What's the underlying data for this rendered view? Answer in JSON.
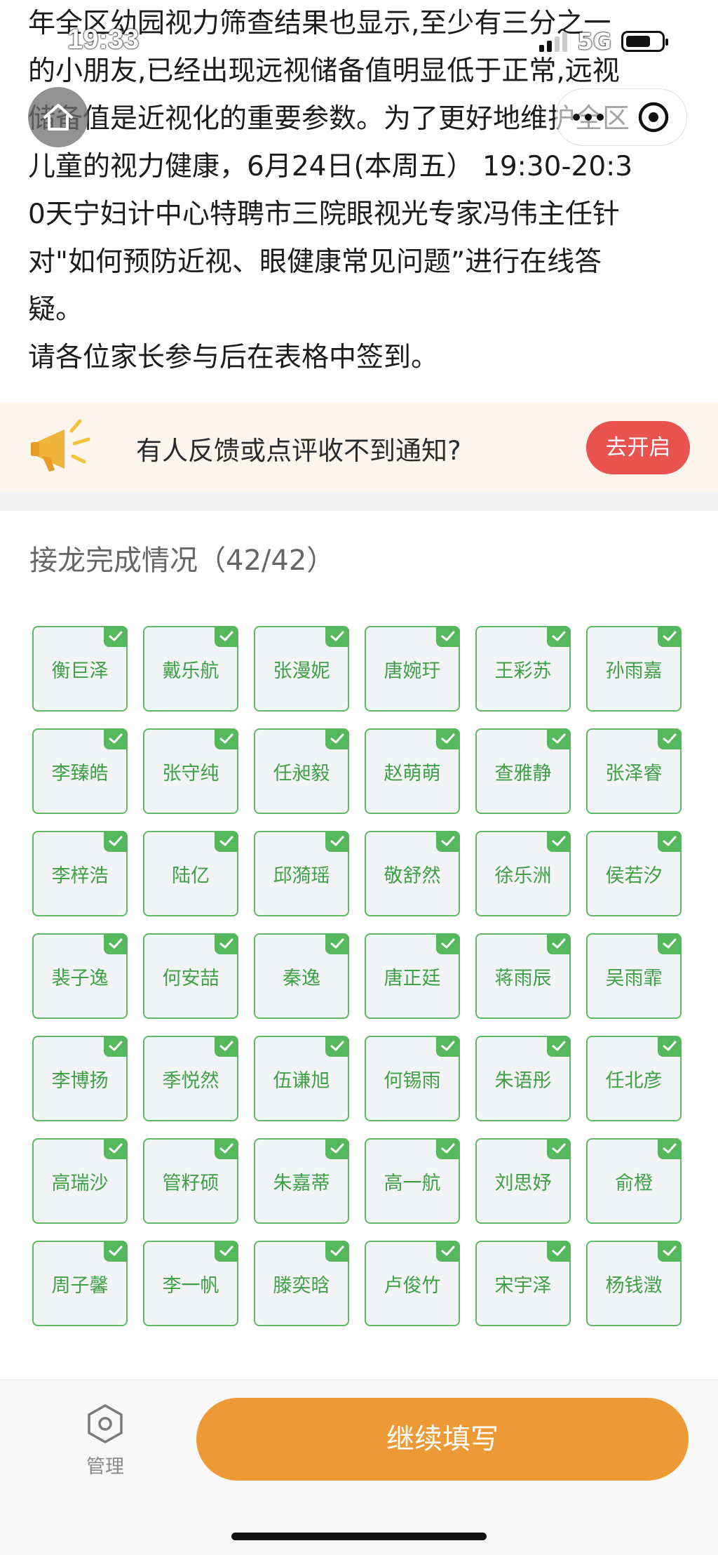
{
  "status_bar": {
    "time": "19:33",
    "network": "5G"
  },
  "article": {
    "lines": [
      "年全区幼园视力筛查结果也显示,至少有三分之一",
      "的小朋友,已经出现远视储备值明显低于正常,远视",
      "储备值是近视化的重要参数。为了更好地维护全区",
      "儿童的视力健康，6月24日(本周五） 19:30-20:3",
      "0天宁妇计中心特聘市三院眼视光专家冯伟主任针",
      "对\"如何预防近视、眼健康常见问题”进行在线答",
      "疑。"
    ],
    "signin_note": "请各位家长参与后在表格中签到。"
  },
  "banner": {
    "text": "有人反馈或点评收不到通知?",
    "button": "去开启"
  },
  "roster": {
    "title": "接龙完成情况（42/42）",
    "names": [
      "衡巨泽",
      "戴乐航",
      "张漫妮",
      "唐婉玗",
      "王彩苏",
      "孙雨嘉",
      "李臻皓",
      "张守纯",
      "任昶毅",
      "赵萌萌",
      "查雅静",
      "张泽睿",
      "李梓浩",
      "陆亿",
      "邱漪瑶",
      "敬舒然",
      "徐乐洲",
      "侯若汐",
      "裴子逸",
      "何安喆",
      "秦逸",
      "唐正廷",
      "蒋雨辰",
      "吴雨霏",
      "李博扬",
      "季悦然",
      "伍谦旭",
      "何锡雨",
      "朱语彤",
      "任北彦",
      "高瑞沙",
      "管籽硕",
      "朱嘉蒂",
      "高一航",
      "刘思妤",
      "俞橙",
      "周子馨",
      "李一帆",
      "滕奕晗",
      "卢俊竹",
      "宋宇泽",
      "杨钱澂"
    ]
  },
  "bottom": {
    "manage_label": "管理",
    "continue_label": "继续填写"
  },
  "colors": {
    "accent_green": "#5dbb63",
    "cta_orange": "#ed9a36",
    "alert_red": "#e8524f"
  }
}
